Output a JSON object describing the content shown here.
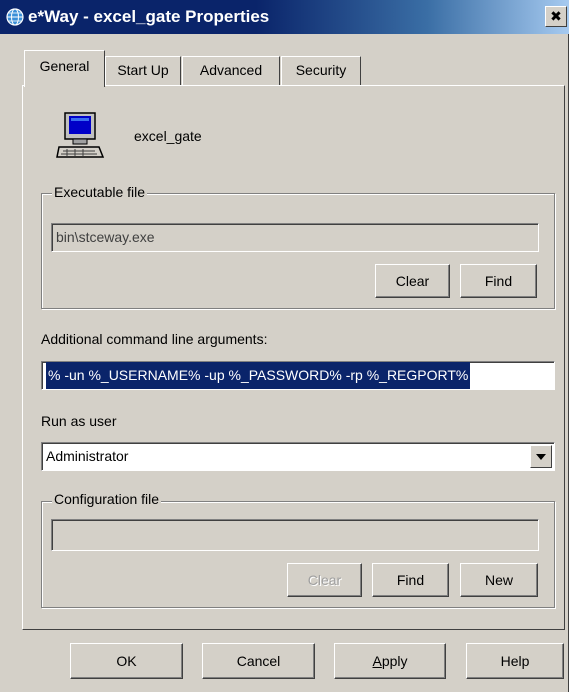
{
  "window": {
    "title": "e*Way - excel_gate Properties",
    "close_glyph": "✖"
  },
  "tabs": [
    {
      "label": "General",
      "active": true
    },
    {
      "label": "Start Up",
      "active": false
    },
    {
      "label": "Advanced",
      "active": false
    },
    {
      "label": "Security",
      "active": false
    }
  ],
  "general": {
    "component_name": "excel_gate",
    "component_icon": "computer-icon",
    "executable": {
      "group_label": "Executable file",
      "value": "bin\\stceway.exe",
      "clear_label": "Clear",
      "find_label": "Find"
    },
    "arguments": {
      "label": "Additional command line arguments:",
      "value": "% -un %_USERNAME% -up %_PASSWORD% -rp %_REGPORT%"
    },
    "run_as": {
      "label": "Run as user",
      "selected": "Administrator"
    },
    "config": {
      "group_label": "Configuration file",
      "value": "",
      "clear_label": "Clear",
      "find_label": "Find",
      "new_label": "New"
    }
  },
  "footer": {
    "ok_label": "OK",
    "cancel_label": "Cancel",
    "apply_label_first": "A",
    "apply_label_rest": "pply",
    "help_label": "Help"
  },
  "colors": {
    "dialog_bg": "#d4d0c8",
    "title_bar": "#0a246a",
    "selection": "#0a246a"
  }
}
